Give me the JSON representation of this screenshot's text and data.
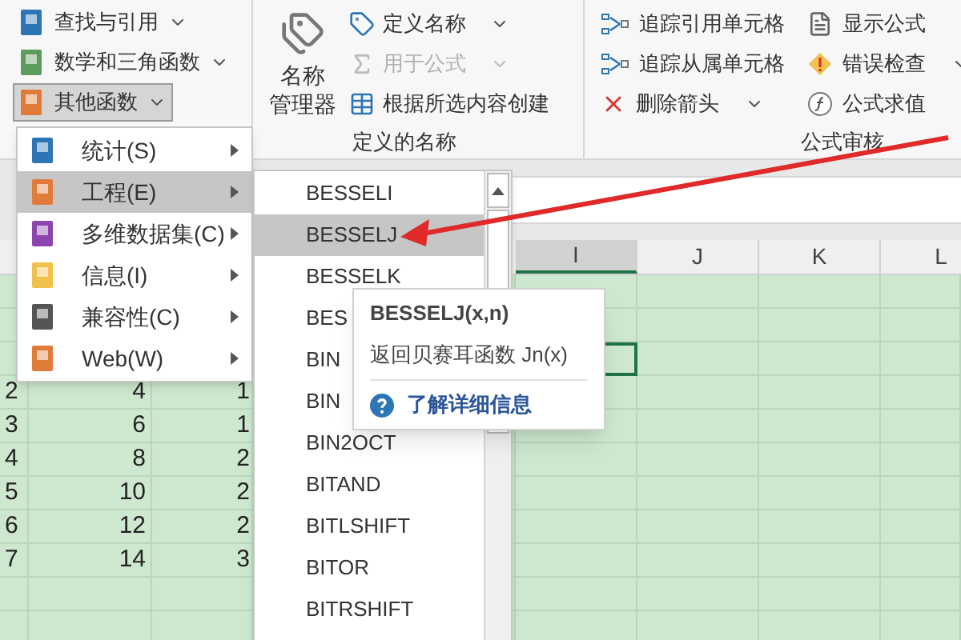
{
  "ribbon": {
    "function_library": [
      {
        "label": "查找与引用",
        "dropdown": true,
        "selected": false
      },
      {
        "label": "数学和三角函数",
        "dropdown": true,
        "selected": false
      },
      {
        "label": "其他函数",
        "dropdown": true,
        "selected": true
      }
    ],
    "defined_names": {
      "large_button": [
        "名称",
        "管理器"
      ],
      "items": [
        {
          "label": "定义名称",
          "dropdown": true,
          "disabled": false
        },
        {
          "label": "用于公式",
          "dropdown": true,
          "disabled": true
        },
        {
          "label": "根据所选内容创建",
          "dropdown": false,
          "disabled": false
        }
      ],
      "group_label": "定义的名称"
    },
    "formula_auditing": {
      "columns": [
        [
          {
            "label": "追踪引用单元格",
            "dropdown": false
          },
          {
            "label": "追踪从属单元格",
            "dropdown": false
          },
          {
            "label": "删除箭头",
            "dropdown": true
          }
        ],
        [
          {
            "label": "显示公式",
            "dropdown": false
          },
          {
            "label": "错误检查",
            "dropdown": true
          },
          {
            "label": "公式求值",
            "dropdown": false
          }
        ]
      ],
      "group_label": "公式审核"
    }
  },
  "grid": {
    "columns": [
      {
        "label": "I",
        "selected": true
      },
      {
        "label": "J",
        "selected": false
      },
      {
        "label": "K",
        "selected": false
      },
      {
        "label": "L",
        "selected": false
      }
    ],
    "rows": [
      {
        "row_header": "2",
        "values": [
          "4",
          "1"
        ]
      },
      {
        "row_header": "3",
        "values": [
          "6",
          "1"
        ]
      },
      {
        "row_header": "4",
        "values": [
          "8",
          "2"
        ]
      },
      {
        "row_header": "5",
        "values": [
          "10",
          "2"
        ]
      },
      {
        "row_header": "6",
        "values": [
          "12",
          "2"
        ]
      },
      {
        "row_header": "7",
        "values": [
          "14",
          "3"
        ]
      }
    ]
  },
  "menu": {
    "items": [
      {
        "label": "统计(S)",
        "selected": false
      },
      {
        "label": "工程(E)",
        "selected": true
      },
      {
        "label": "多维数据集(C)",
        "selected": false
      },
      {
        "label": "信息(I)",
        "selected": false
      },
      {
        "label": "兼容性(C)",
        "selected": false
      },
      {
        "label": "Web(W)",
        "selected": false
      }
    ]
  },
  "submenu": {
    "items": [
      {
        "label": "BESSELI",
        "selected": false
      },
      {
        "label": "BESSELJ",
        "selected": true
      },
      {
        "label": "BESSELK",
        "selected": false
      },
      {
        "label": "BES",
        "selected": false
      },
      {
        "label": "BIN",
        "selected": false
      },
      {
        "label": "BIN",
        "selected": false
      },
      {
        "label": "BIN2OCT",
        "selected": false
      },
      {
        "label": "BITAND",
        "selected": false
      },
      {
        "label": "BITLSHIFT",
        "selected": false
      },
      {
        "label": "BITOR",
        "selected": false
      },
      {
        "label": "BITRSHIFT",
        "selected": false
      }
    ]
  },
  "tooltip": {
    "title": "BESSELJ(x,n)",
    "description": "返回贝赛耳函数 Jn(x)",
    "link": "了解详细信息"
  }
}
